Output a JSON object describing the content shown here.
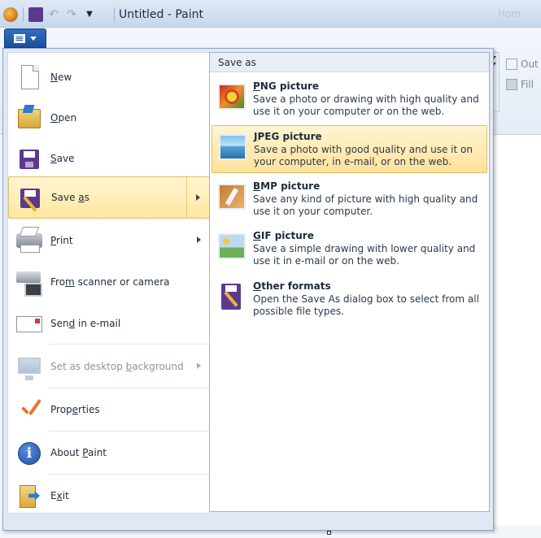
{
  "window": {
    "title": "Untitled - Paint",
    "right_blurred_text": "Hom"
  },
  "quick_access": {
    "items": [
      "paint-app-icon",
      "save-icon",
      "undo-icon",
      "redo-icon",
      "customize-dropdown-icon"
    ]
  },
  "ribbon": {
    "outline_label": "Out",
    "fill_label": "Fill"
  },
  "app_menu": {
    "items": [
      {
        "label_pre": "",
        "label_u": "N",
        "label_post": "ew",
        "icon": "new-document-icon"
      },
      {
        "label_pre": "",
        "label_u": "O",
        "label_post": "pen",
        "icon": "open-folder-icon"
      },
      {
        "label_pre": "",
        "label_u": "S",
        "label_post": "ave",
        "icon": "save-disk-icon"
      },
      {
        "label_pre": "Save ",
        "label_u": "a",
        "label_post": "s",
        "icon": "save-as-icon"
      },
      {
        "label_pre": "",
        "label_u": "P",
        "label_post": "rint",
        "icon": "printer-icon"
      },
      {
        "label_pre": "Fro",
        "label_u": "m",
        "label_post": " scanner or camera",
        "icon": "scanner-icon"
      },
      {
        "label_pre": "Sen",
        "label_u": "d",
        "label_post": " in e-mail",
        "icon": "email-icon"
      },
      {
        "label_pre": "Set as desktop ",
        "label_u": "b",
        "label_post": "ackground",
        "icon": "desktop-background-icon"
      },
      {
        "label_pre": "Prop",
        "label_u": "e",
        "label_post": "rties",
        "icon": "properties-checkmark-icon"
      },
      {
        "label_pre": "About ",
        "label_u": "P",
        "label_post": "aint",
        "icon": "info-icon"
      },
      {
        "label_pre": "E",
        "label_u": "x",
        "label_post": "it",
        "icon": "exit-icon"
      }
    ]
  },
  "save_as": {
    "header": "Save as",
    "options": [
      {
        "title_u": "P",
        "title_post": "NG picture",
        "desc": "Save a photo or drawing with high quality and use it on your computer or on the web.",
        "icon": "png-picture-icon"
      },
      {
        "title_u": "J",
        "title_post": "PEG picture",
        "desc": "Save a photo with good quality and use it on your computer, in e-mail, or on the web.",
        "icon": "jpeg-picture-icon"
      },
      {
        "title_u": "B",
        "title_post": "MP picture",
        "desc": "Save any kind of picture with high quality and use it on your computer.",
        "icon": "bmp-picture-icon"
      },
      {
        "title_u": "G",
        "title_post": "IF picture",
        "desc": "Save a simple drawing with lower quality and use it in e-mail or on the web.",
        "icon": "gif-picture-icon"
      },
      {
        "title_u": "O",
        "title_post": "ther formats",
        "desc": "Open the Save As dialog box to select from all possible file types.",
        "icon": "other-formats-icon"
      }
    ]
  }
}
